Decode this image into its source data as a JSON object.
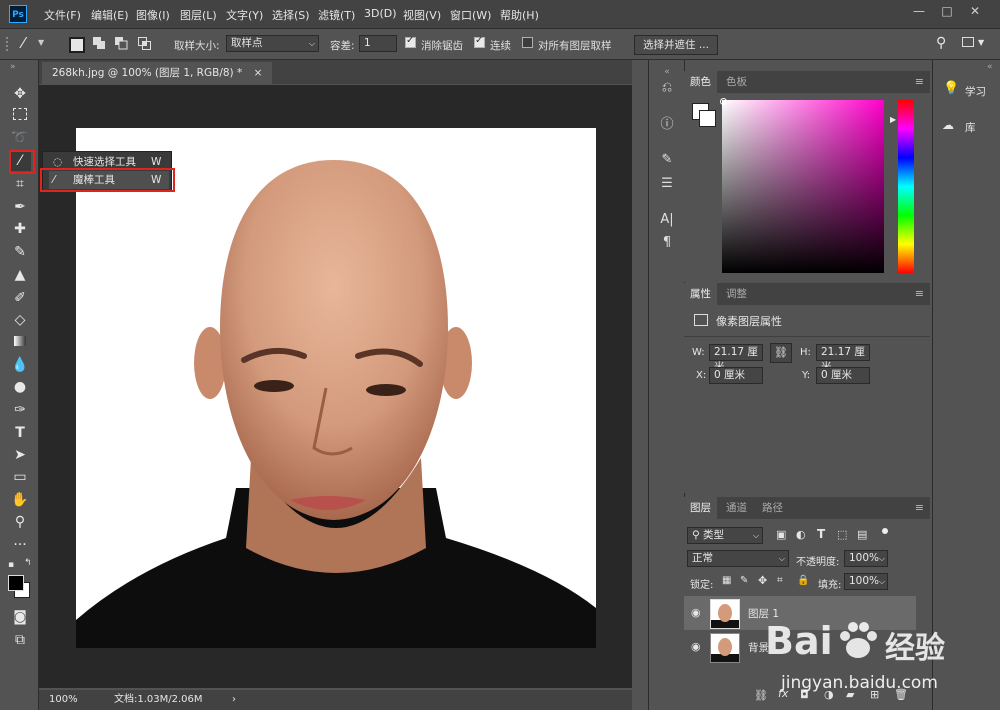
{
  "app": {
    "logo": "Ps"
  },
  "menu": [
    "文件(F)",
    "编辑(E)",
    "图像(I)",
    "图层(L)",
    "文字(Y)",
    "选择(S)",
    "滤镜(T)",
    "3D(D)",
    "视图(V)",
    "窗口(W)",
    "帮助(H)"
  ],
  "window_controls": {
    "minimize": "—",
    "maximize": "□",
    "close": "✕"
  },
  "options_bar": {
    "sample_size_label": "取样大小:",
    "sample_size_value": "取样点",
    "tolerance_label": "容差:",
    "tolerance_value": "1",
    "antialias_label": "消除锯齿",
    "antialias_checked": true,
    "contiguous_label": "连续",
    "contiguous_checked": true,
    "sample_all_label": "对所有图层取样",
    "sample_all_checked": false,
    "select_mask_button": "选择并遮住 ..."
  },
  "document": {
    "tab_title": "268kh.jpg @ 100% (图层 1, RGB/8) *",
    "close": "×",
    "zoom": "100%",
    "doc_info": "文档:1.03M/2.06M",
    "status_arrow": "›"
  },
  "tool_flyout": {
    "items": [
      {
        "label": "快速选择工具",
        "shortcut": "W",
        "active": false
      },
      {
        "label": "魔棒工具",
        "shortcut": "W",
        "active": true
      }
    ]
  },
  "color_panel": {
    "tabs": [
      "颜色",
      "色板"
    ],
    "active_tab": "颜色",
    "base_hue": "#ff00cc"
  },
  "properties_panel": {
    "tabs": [
      "属性",
      "调整"
    ],
    "title": "像素图层属性",
    "w_label": "W:",
    "w_value": "21.17 厘米",
    "h_label": "H:",
    "h_value": "21.17 厘米",
    "x_label": "X:",
    "x_value": "0 厘米",
    "y_label": "Y:",
    "y_value": "0 厘米"
  },
  "layers_panel": {
    "tabs": [
      "图层",
      "通道",
      "路径"
    ],
    "filter_label": "类型",
    "blend_mode": "正常",
    "opacity_label": "不透明度:",
    "opacity_value": "100%",
    "lock_label": "锁定:",
    "fill_label": "填充:",
    "fill_value": "100%",
    "layers": [
      {
        "name": "图层 1",
        "visible": true,
        "selected": true
      },
      {
        "name": "背景",
        "visible": true,
        "selected": false
      }
    ],
    "footer_fx": "fx"
  },
  "learn_panel": {
    "items": [
      {
        "label": "学习",
        "icon": "lightbulb-icon"
      },
      {
        "label": "库",
        "icon": "cc-libraries-icon"
      }
    ]
  },
  "watermark": {
    "brand": "Bai",
    "brand2": "经验",
    "url": "jingyan.baidu.com"
  }
}
